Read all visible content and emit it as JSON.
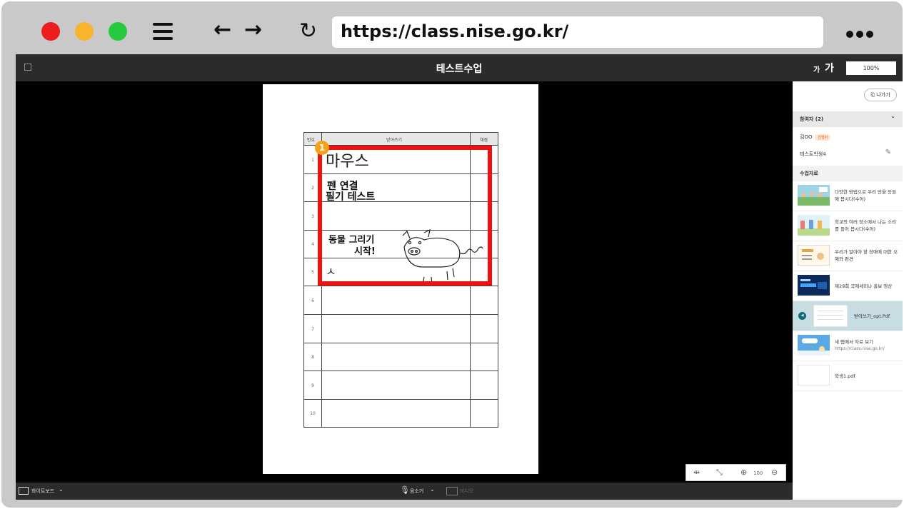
{
  "browser": {
    "url": "https://class.nise.go.kr/",
    "back_glyph": "←",
    "forward_glyph": "→",
    "reload_glyph": "↻"
  },
  "app": {
    "title": "테스트수업",
    "font_small": "가",
    "font_large": "가",
    "zoom": "100%"
  },
  "document": {
    "headers": {
      "num": "번호",
      "dictation": "받아쓰기",
      "check": "채점"
    },
    "rows": [
      "1",
      "2",
      "3",
      "4",
      "5",
      "6",
      "7",
      "8",
      "9",
      "10"
    ],
    "marker": "1",
    "handwriting": {
      "line1": "마우스",
      "line2a": "펜 연결",
      "line2b": "필기 테스트",
      "line4a": "동물 그리기",
      "line4b": "시작!",
      "line5": "ㅅ"
    }
  },
  "zoom_control": {
    "value": "100"
  },
  "bottombar": {
    "whiteboard_label": "화이트보드",
    "mic_label": "음소거",
    "video_label": "비디오"
  },
  "sidebar": {
    "exit_label": "나가기",
    "participants_header": "참여자 (2)",
    "participants": [
      {
        "name": "김OO",
        "badge": "진행자"
      },
      {
        "name": "테스트학생4"
      }
    ],
    "materials_header": "수업자료",
    "materials": [
      {
        "title": "다양한 방법으로 우리 반을 응원해 봅시다(수어)"
      },
      {
        "title": "학교의 여러 장소에서 나는 소리를 들어 봅시다(수어)"
      },
      {
        "title": "우리가 알아야 할 장애에 대한 오해와 편견"
      },
      {
        "title": "제29회 국제세미나 홍보 영상"
      },
      {
        "title": "받아쓰기_opt.Pdf",
        "selected": true
      },
      {
        "title": "새 탭에서 자료 보기",
        "url": "https://class.nise.go.kr/"
      },
      {
        "title": "학생1.pdf"
      }
    ]
  },
  "colors": {
    "highlight": "#ef1010",
    "marker": "#f4a21b",
    "selected_row": "#c8dde2",
    "topbar": "#2b2b2b"
  }
}
